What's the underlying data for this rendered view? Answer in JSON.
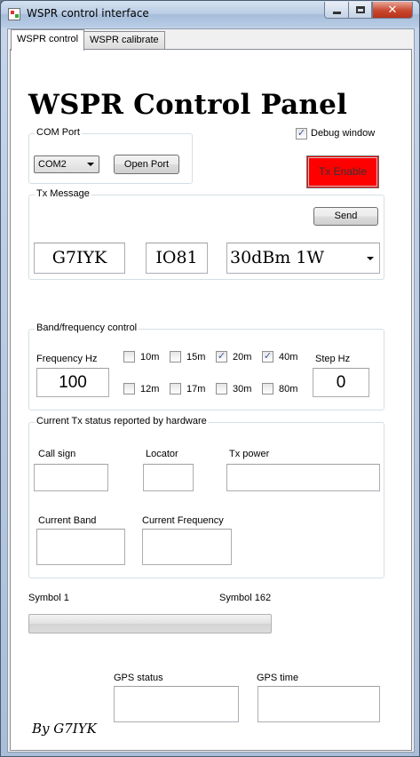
{
  "window": {
    "title": "WSPR control interface",
    "minimize": "",
    "maximize": "",
    "close": "✕"
  },
  "tabs": [
    {
      "label": "WSPR control"
    },
    {
      "label": "WSPR calibrate"
    }
  ],
  "heading": "WSPR Control Panel",
  "com_port": {
    "group_label": "COM Port",
    "selected": "COM2",
    "open_button": "Open Port"
  },
  "debug": {
    "label": "Debug window",
    "checked": true,
    "mark": "✓"
  },
  "tx_enable": {
    "label": "Tx Enable",
    "color": "#ff0000"
  },
  "tx_message": {
    "group_label": "Tx Message",
    "send_button": "Send",
    "callsign": "G7IYK",
    "locator": "IO81",
    "power_selected": "30dBm 1W"
  },
  "band": {
    "group_label": "Band/frequency control",
    "freq_label": "Frequency Hz",
    "freq_value": "100",
    "step_label": "Step Hz",
    "step_value": "0",
    "bands": [
      {
        "label": "10m",
        "checked": false
      },
      {
        "label": "15m",
        "checked": false
      },
      {
        "label": "20m",
        "checked": true
      },
      {
        "label": "40m",
        "checked": true
      },
      {
        "label": "12m",
        "checked": false
      },
      {
        "label": "17m",
        "checked": false
      },
      {
        "label": "30m",
        "checked": false
      },
      {
        "label": "80m",
        "checked": false
      }
    ],
    "check_mark": "✓"
  },
  "status": {
    "group_label": "Current Tx status reported by hardware",
    "callsign_label": "Call sign",
    "locator_label": "Locator",
    "power_label": "Tx power",
    "band_label": "Current Band",
    "frequency_label": "Current Frequency",
    "callsign_value": "",
    "locator_value": "",
    "power_value": "",
    "band_value": "",
    "frequency_value": ""
  },
  "progress": {
    "start_label": "Symbol 1",
    "end_label": "Symbol 162",
    "fraction": 0
  },
  "gps": {
    "status_label": "GPS status",
    "time_label": "GPS time",
    "status_value": "",
    "time_value": ""
  },
  "signature": "By G7IYK"
}
